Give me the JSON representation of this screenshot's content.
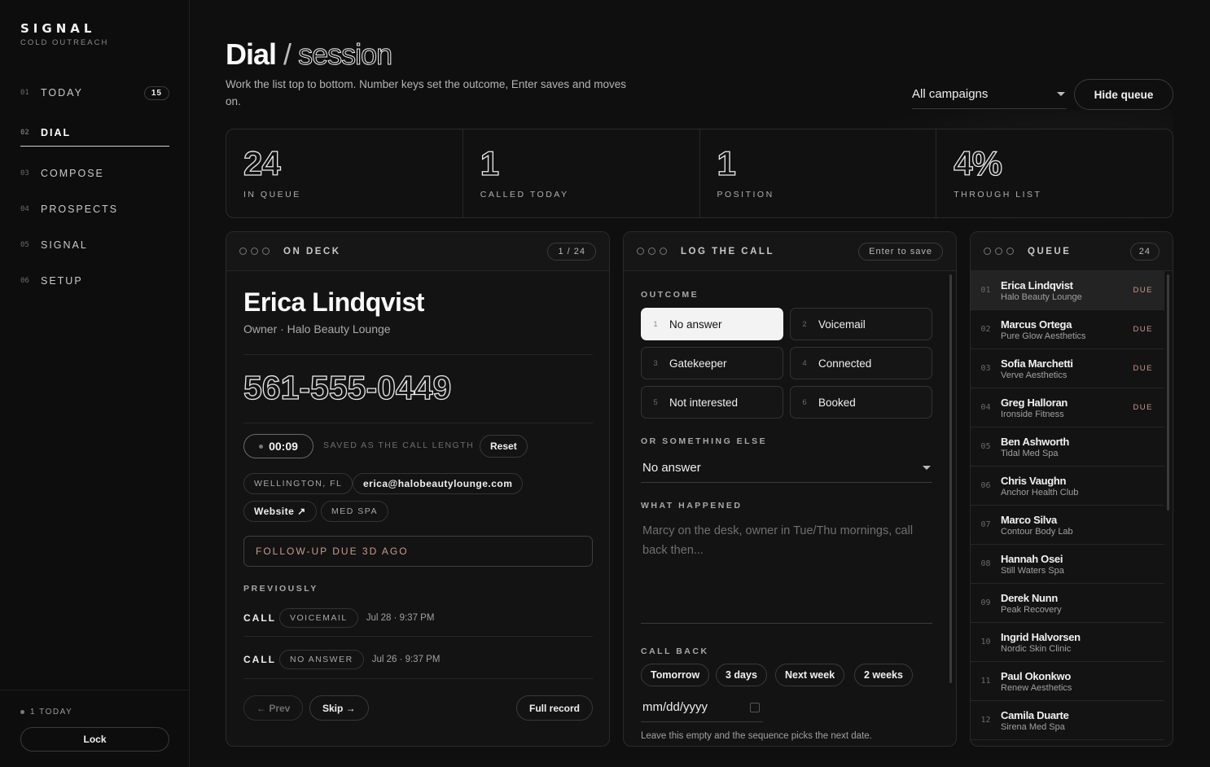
{
  "brand": {
    "name": "SIGNAL",
    "subtitle": "COLD OUTREACH"
  },
  "nav": [
    {
      "num": "01",
      "label": "TODAY",
      "badge": "15"
    },
    {
      "num": "02",
      "label": "DIAL",
      "active": true
    },
    {
      "num": "03",
      "label": "COMPOSE"
    },
    {
      "num": "04",
      "label": "PROSPECTS"
    },
    {
      "num": "05",
      "label": "SIGNAL"
    },
    {
      "num": "06",
      "label": "SETUP"
    }
  ],
  "footer": {
    "today": "1 TODAY",
    "lock": "Lock"
  },
  "header": {
    "title_main": "Dial",
    "title_slash": "/",
    "title_alt": "session",
    "subtitle": "Work the list top to bottom. Number keys set the outcome, Enter saves and moves on.",
    "campaign_select": "All campaigns",
    "hide_queue": "Hide queue"
  },
  "stats": [
    {
      "value": "24",
      "label": "IN QUEUE"
    },
    {
      "value": "1",
      "label": "CALLED TODAY"
    },
    {
      "value": "1",
      "label": "POSITION"
    },
    {
      "value": "4%",
      "label": "THROUGH LIST"
    }
  ],
  "ondeck": {
    "title": "ON DECK",
    "counter": "1 / 24",
    "name": "Erica Lindqvist",
    "role": "Owner · Halo Beauty Lounge",
    "phone": "561-555-0449",
    "timer": "00:09",
    "saved_note": "SAVED AS THE CALL LENGTH",
    "reset": "Reset",
    "location": "WELLINGTON, FL",
    "email": "erica@halobeautylounge.com",
    "website": "Website ↗",
    "category": "MED SPA",
    "followup": "FOLLOW-UP DUE 3D AGO",
    "previously_label": "PREVIOUSLY",
    "history": [
      {
        "type": "CALL",
        "result": "VOICEMAIL",
        "date": "Jul 28 · 9:37 PM"
      },
      {
        "type": "CALL",
        "result": "NO ANSWER",
        "date": "Jul 26 · 9:37 PM"
      }
    ],
    "prev": "← Prev",
    "skip": "Skip →",
    "full_record": "Full record"
  },
  "log": {
    "title": "LOG THE CALL",
    "enter_hint": "Enter to save",
    "outcome_label": "OUTCOME",
    "outcomes": [
      {
        "key": "1",
        "label": "No answer",
        "selected": true
      },
      {
        "key": "2",
        "label": "Voicemail"
      },
      {
        "key": "3",
        "label": "Gatekeeper"
      },
      {
        "key": "4",
        "label": "Connected"
      },
      {
        "key": "5",
        "label": "Not interested"
      },
      {
        "key": "6",
        "label": "Booked"
      }
    ],
    "else_label": "OR SOMETHING ELSE",
    "else_value": "No answer",
    "what_label": "WHAT HAPPENED",
    "what_placeholder": "Marcy on the desk, owner in Tue/Thu mornings, call back then...",
    "callback_label": "CALL BACK",
    "quick": [
      "Tomorrow",
      "3 days",
      "Next week",
      "2 weeks"
    ],
    "date_placeholder": "mm/dd/yyyy",
    "hint": "Leave this empty and the sequence picks the next date."
  },
  "queue": {
    "title": "QUEUE",
    "count": "24",
    "items": [
      {
        "num": "01",
        "name": "Erica Lindqvist",
        "biz": "Halo Beauty Lounge",
        "due": "DUE"
      },
      {
        "num": "02",
        "name": "Marcus Ortega",
        "biz": "Pure Glow Aesthetics",
        "due": "DUE"
      },
      {
        "num": "03",
        "name": "Sofia Marchetti",
        "biz": "Verve Aesthetics",
        "due": "DUE"
      },
      {
        "num": "04",
        "name": "Greg Halloran",
        "biz": "Ironside Fitness",
        "due": "DUE"
      },
      {
        "num": "05",
        "name": "Ben Ashworth",
        "biz": "Tidal Med Spa",
        "due": ""
      },
      {
        "num": "06",
        "name": "Chris Vaughn",
        "biz": "Anchor Health Club",
        "due": ""
      },
      {
        "num": "07",
        "name": "Marco Silva",
        "biz": "Contour Body Lab",
        "due": ""
      },
      {
        "num": "08",
        "name": "Hannah Osei",
        "biz": "Still Waters Spa",
        "due": ""
      },
      {
        "num": "09",
        "name": "Derek Nunn",
        "biz": "Peak Recovery",
        "due": ""
      },
      {
        "num": "10",
        "name": "Ingrid Halvorsen",
        "biz": "Nordic Skin Clinic",
        "due": ""
      },
      {
        "num": "11",
        "name": "Paul Okonkwo",
        "biz": "Renew Aesthetics",
        "due": ""
      },
      {
        "num": "12",
        "name": "Camila Duarte",
        "biz": "Sirena Med Spa",
        "due": ""
      }
    ]
  },
  "colors": {
    "background": "#0f0f0f",
    "accent_due": "#c69b8b",
    "selected": "#f3f3f3"
  },
  "icons": [
    "window-dots-icon",
    "caret-down-icon",
    "calendar-icon",
    "status-dot-icon"
  ]
}
